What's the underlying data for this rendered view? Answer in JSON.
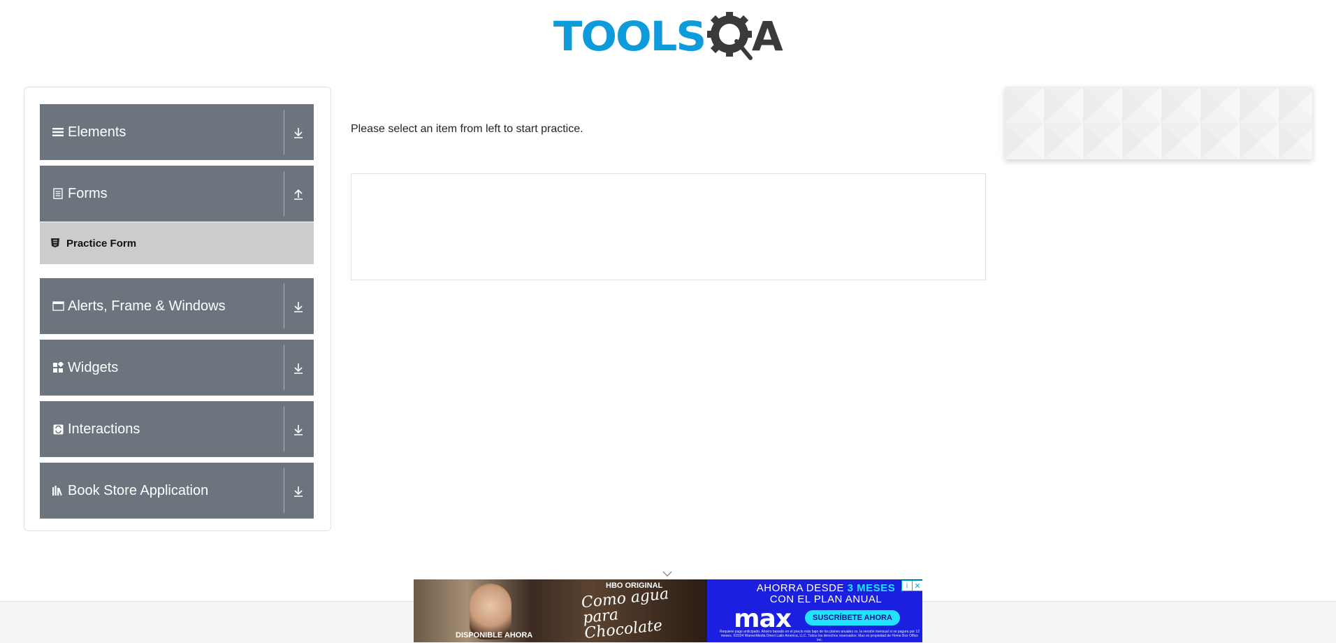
{
  "header": {
    "logo_tools": "TOOLS",
    "logo_qa_a": "A"
  },
  "sidebar": {
    "groups": [
      {
        "title": "Elements",
        "icon": "list-icon",
        "state": "collapsed"
      },
      {
        "title": "Forms",
        "icon": "form-icon",
        "state": "expanded",
        "items": [
          {
            "label": "Practice Form",
            "icon": "html5-icon"
          }
        ]
      },
      {
        "title": "Alerts, Frame & Windows",
        "icon": "window-icon",
        "state": "collapsed"
      },
      {
        "title": "Widgets",
        "icon": "widgets-icon",
        "state": "collapsed"
      },
      {
        "title": "Interactions",
        "icon": "interactions-icon",
        "state": "collapsed"
      },
      {
        "title": "Book Store Application",
        "icon": "books-icon",
        "state": "collapsed"
      }
    ]
  },
  "main": {
    "prompt": "Please select an item from left to start practice."
  },
  "ad_banner": {
    "brand_line": "HBO ORIGINAL",
    "title_script": "Como agua para Chocolate",
    "available": "DISPONIBLE AHORA",
    "offer_line1_prefix": "AHORRA DESDE",
    "offer_line1_highlight": "3 MESES",
    "offer_line2": "CON EL PLAN ANUAL",
    "brand": "max",
    "cta": "SUSCRÍBETE AHORA",
    "fine_print": "Requiere pago anticipado. Ahorro basado en el precio más bajo de los planes anuales vs. la versión mensual si se pagara por 12 meses. ©2024 WarnerMedia Direct Latin America, LLC. Todos los derechos reservados. Max es propiedad de Home Box Office Inc.",
    "adchoices_label": "i",
    "close_label": "✕"
  },
  "colors": {
    "accent_blue": "#0d9bdb",
    "logo_dark": "#3a3a3a",
    "group_header_bg": "#6c757d",
    "active_item_bg": "#cccccc",
    "banner_bg": "#1a1fe0",
    "banner_highlight": "#22e3ff"
  }
}
